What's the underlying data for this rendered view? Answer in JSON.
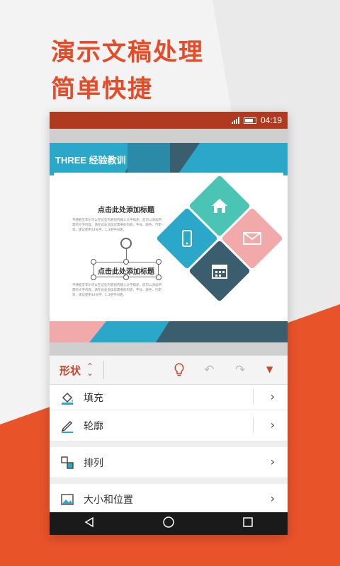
{
  "promo": {
    "line1": "演示文稿处理",
    "line2": "简单快捷"
  },
  "status_bar": {
    "time": "04:19"
  },
  "slide": {
    "title": "THREE 经验教训",
    "heading1": "点击此处添加标题",
    "heading2": "点击此处添加标题",
    "body1": "韦德殿堂李尔可以在这些内容组内输入文字描述，您可以添加所需的文字内容。请在此处添加您需要的内容，字号、颜色、行距等，建议使用14号字，1.3倍字间距。",
    "body2": "韦德殿堂李尔可以在这些内容组内输入文字描述，您可以添加所需的文字内容。请在此处添加您需要的内容，字号、颜色、行距等，建议使用14号字，1.3倍字间距。",
    "colors": {
      "teal": "#4bc4b6",
      "blue": "#2ba7c9",
      "pink": "#f2a9a9",
      "dark": "#3a5e6e"
    },
    "icons": [
      "home-icon",
      "phone-icon",
      "mail-icon",
      "calendar-icon"
    ]
  },
  "toolbar": {
    "label": "形状",
    "accent": "#c7462b"
  },
  "menu": {
    "fill": "填充",
    "outline": "轮廓",
    "arrange": "排列",
    "size_position": "大小和位置"
  }
}
